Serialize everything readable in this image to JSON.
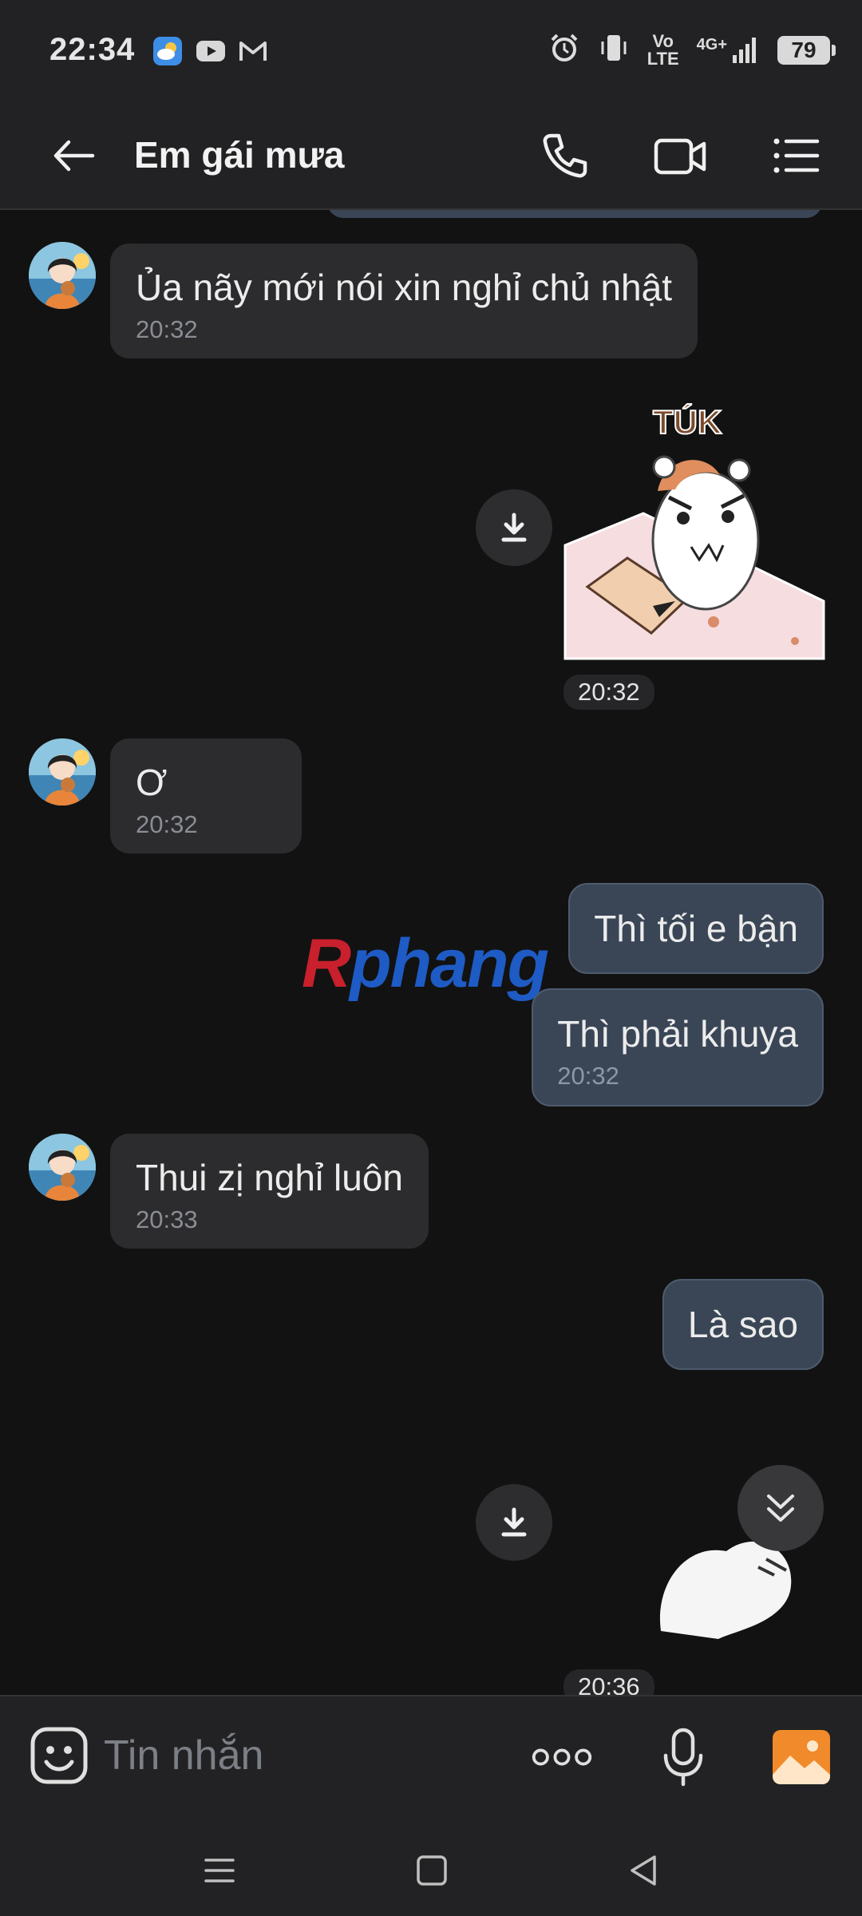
{
  "status_bar": {
    "time": "22:34",
    "network": "VoLTE",
    "signal": "4G+",
    "battery": "79",
    "icons": [
      "weather-icon",
      "youtube-icon",
      "gmail-icon",
      "alarm-icon",
      "vibrate-icon",
      "volte-icon",
      "signal-4g-icon",
      "battery-icon"
    ]
  },
  "header": {
    "title": "Em gái mưa",
    "icons": [
      "back-arrow-icon",
      "phone-icon",
      "video-call-icon",
      "menu-list-icon"
    ]
  },
  "messages": [
    {
      "side": "in",
      "text": "Ủa nãy mới nói xin nghỉ chủ nhật",
      "time": "20:32"
    },
    {
      "side": "out",
      "type": "sticker",
      "sticker_text": "TÚK",
      "time": "20:32"
    },
    {
      "side": "in",
      "text": "Ơ",
      "time": "20:32"
    },
    {
      "side": "out",
      "text": "Thì tối e bận"
    },
    {
      "side": "out",
      "text": "Thì phải khuya",
      "time": "20:32"
    },
    {
      "side": "in",
      "text": "Thui zị nghỉ luôn",
      "time": "20:33"
    },
    {
      "side": "out",
      "text": "Là sao"
    },
    {
      "side": "out",
      "type": "sticker",
      "time": "20:36"
    }
  ],
  "watermark": {
    "first": "R",
    "rest": "phang"
  },
  "input_bar": {
    "placeholder": "Tin nhắn",
    "icons": [
      "emoji-icon",
      "more-dots-icon",
      "microphone-icon",
      "gallery-icon"
    ],
    "accent": "#f08a2a"
  },
  "nav_bar": {
    "icons": [
      "recent-apps-icon",
      "home-icon",
      "back-icon"
    ]
  },
  "colors": {
    "background": "#121212",
    "bar": "#222224",
    "incoming_bubble": "#2c2c2e",
    "outgoing_bubble": "#3a4656"
  }
}
